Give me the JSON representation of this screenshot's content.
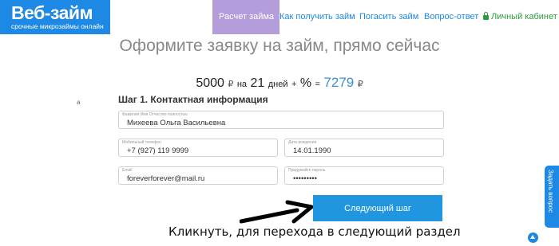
{
  "header": {
    "logo_title": "Веб-займ",
    "logo_subtitle": "срочные микрозаймы онлайн",
    "nav": [
      {
        "label": "Расчет займа",
        "active": true
      },
      {
        "label": "Как получить займ"
      },
      {
        "label": "Погасить займ"
      },
      {
        "label": "Вопрос-ответ"
      },
      {
        "label": "Личный кабинет",
        "icon": "lock-icon"
      }
    ]
  },
  "main": {
    "headline": "Оформите заявку на займ, прямо сейчас",
    "summary": {
      "amount": "5000",
      "currency": "₽",
      "on": "на",
      "days": "21",
      "days_label": "дней",
      "plus": "+",
      "percent": "%",
      "equals": "=",
      "total": "7279",
      "total_currency": "₽"
    },
    "stray_text": "a",
    "step_title": "Шаг 1. Контактная информация",
    "fields": {
      "full_name": {
        "label": "Фамилия Имя Отчество полностью",
        "value": "Михеева Ольга Васильевна"
      },
      "phone": {
        "label": "Мобильный телефон",
        "value": "+7 (927) 119 9999"
      },
      "birth_date": {
        "label": "Дата рождения",
        "value": "14.01.1990"
      },
      "email": {
        "label": "Email",
        "value": "foreverforever@mail.ru"
      },
      "password": {
        "label": "Придумайте пароль",
        "value": "•••••••••"
      }
    },
    "next_button": "Следующий шаг",
    "annotation": "Кликнуть, для перехода в следующий раздел"
  },
  "side_tab": "Задать вопрос",
  "colors": {
    "brand": "#1e88e5",
    "active_tab": "#b39ddb",
    "cabinet": "#2e9b3c",
    "button": "#2196e0"
  }
}
